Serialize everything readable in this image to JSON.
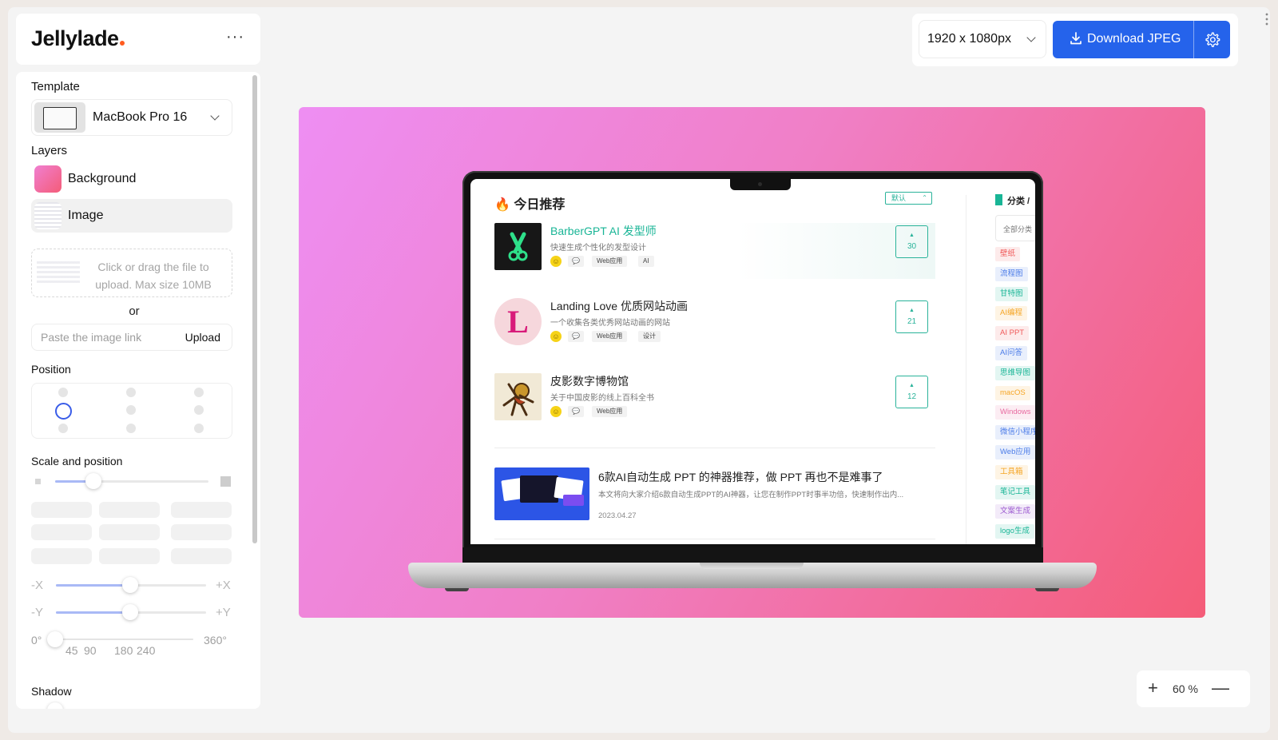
{
  "app": {
    "brand": "Jellylade",
    "more": "···"
  },
  "sidebar": {
    "template_label": "Template",
    "template_value": "MacBook Pro 16",
    "layers_label": "Layers",
    "layers": [
      {
        "label": "Background"
      },
      {
        "label": "Image"
      }
    ],
    "dropzone_text": "Click or drag the file to upload. Max size 10MB",
    "or": "or",
    "link_placeholder": "Paste the image link",
    "upload_label": "Upload",
    "position_label": "Position",
    "scale_label": "Scale and position",
    "axis": {
      "neg_x": "-X",
      "pos_x": "+X",
      "neg_y": "-Y",
      "pos_y": "+Y"
    },
    "rotation": {
      "min": "0°",
      "t1": "45",
      "t2": "90",
      "t3": "180",
      "t4": "240",
      "max": "360°"
    },
    "shadow_label": "Shadow"
  },
  "toolbar": {
    "size": "1920 x 1080px",
    "download": "Download JPEG"
  },
  "zoom": {
    "plus": "+",
    "value": "60 %",
    "minus": "—"
  },
  "colors": {
    "accent": "#2563eb",
    "teal": "#19b596",
    "bg_from": "#ee8ef3",
    "bg_to": "#f45c78"
  },
  "screen": {
    "title": "🔥 今日推荐",
    "sort": "默认",
    "items": [
      {
        "title": "BarberGPT AI 发型师",
        "desc": "快速生成个性化的发型设计",
        "tags": [
          "Web应用",
          "AI"
        ],
        "votes": "30",
        "chat": "💬"
      },
      {
        "title": "Landing Love 优质网站动画",
        "desc": "一个收集各类优秀网站动画的网站",
        "tags": [
          "Web应用",
          "设计"
        ],
        "votes": "21",
        "chat": "💬",
        "logo_letter": "L"
      },
      {
        "title": "皮影数字博物馆",
        "desc": "关于中国皮影的线上百科全书",
        "tags": [
          "Web应用"
        ],
        "votes": "12",
        "chat": "💬"
      }
    ],
    "article": {
      "title": "6款AI自动生成 PPT 的神器推荐，做 PPT 再也不是难事了",
      "desc": "本文将向大家介绍6款自动生成PPT的AI神器，让您在制作PPT时事半功倍，快速制作出内...",
      "date": "2023.04.27"
    },
    "side": {
      "head": "分类 /",
      "search": "全部分类",
      "tags": [
        "壁纸",
        "流程图",
        "甘特图",
        "AI编程",
        "AI PPT",
        "AI问答",
        "思维导图",
        "macOS",
        "Windows",
        "微信小程序",
        "Web应用",
        "工具箱",
        "笔记工具",
        "文案生成",
        "logo生成"
      ],
      "tag_colors": [
        "#f05a5a",
        "#4a7be8",
        "#19b596",
        "#f5a524",
        "#f05a5a",
        "#4a7be8",
        "#19b596",
        "#f5a524",
        "#e86aa0",
        "#4a7be8",
        "#4a7be8",
        "#f5a524",
        "#19b596",
        "#9b59d0",
        "#19b596"
      ]
    }
  }
}
